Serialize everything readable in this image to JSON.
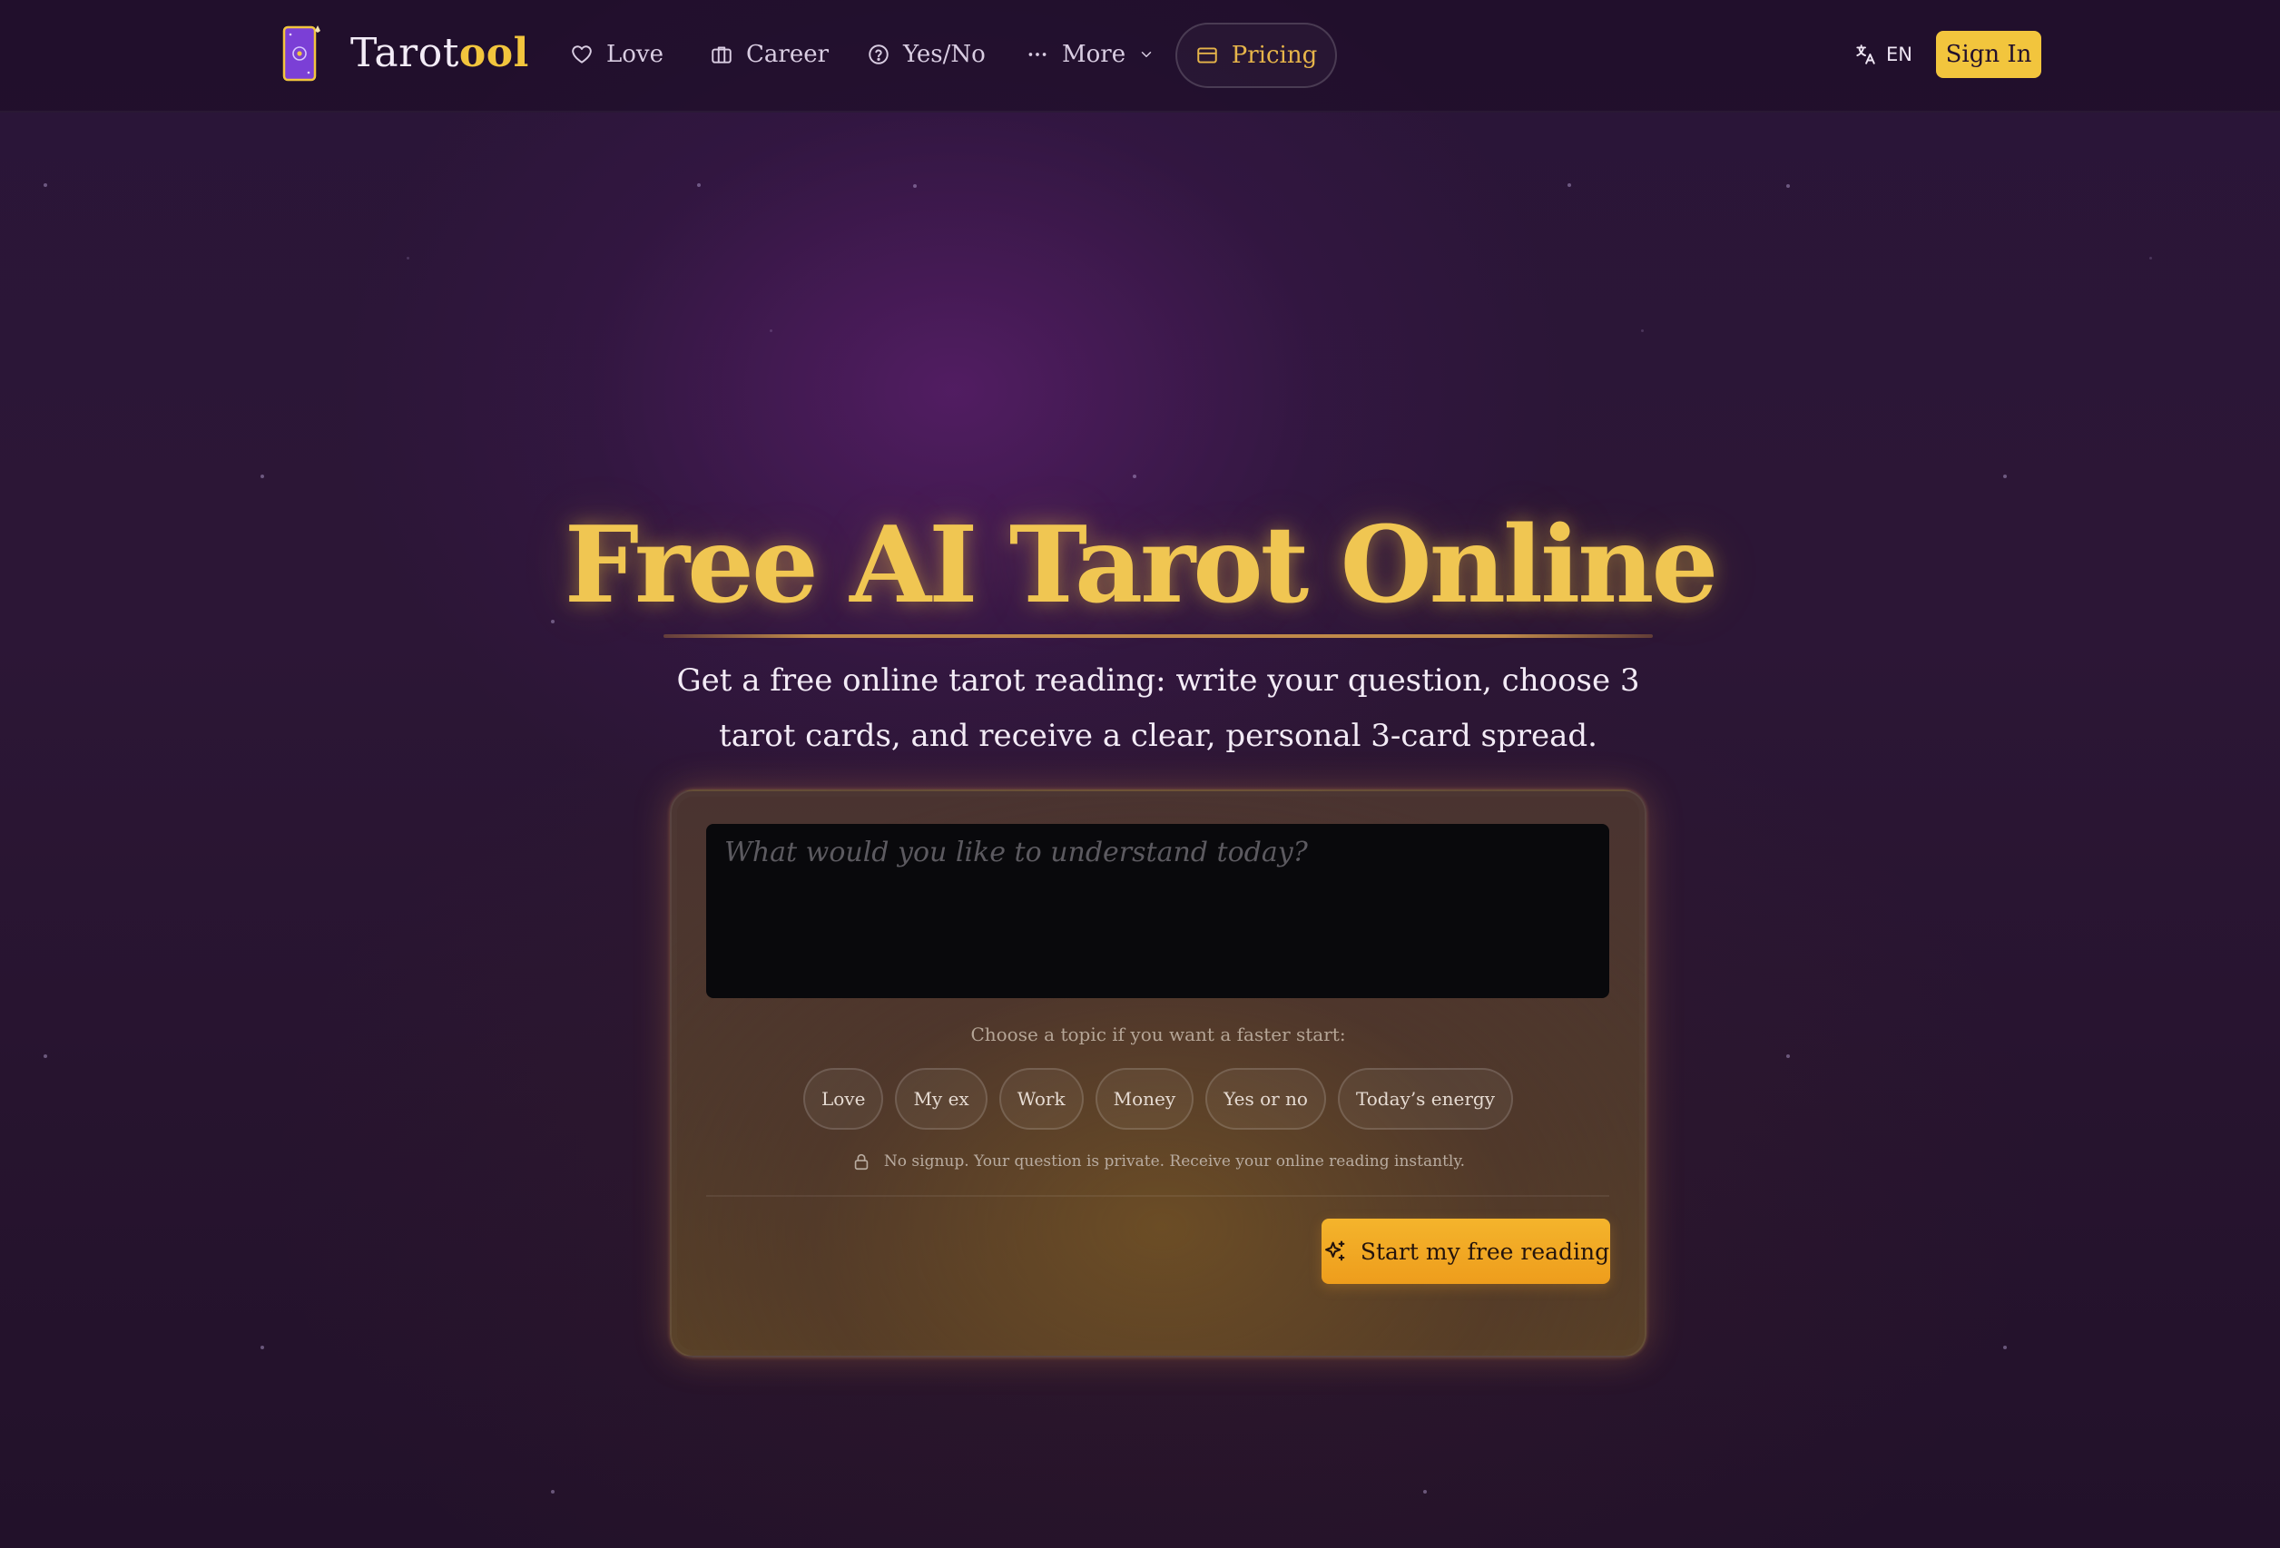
{
  "header": {
    "brand_main": "Tarot",
    "brand_accent": "ool",
    "nav": [
      {
        "label": "Love",
        "icon": "heart-icon"
      },
      {
        "label": "Career",
        "icon": "briefcase-icon"
      },
      {
        "label": "Yes/No",
        "icon": "question-circle-icon"
      },
      {
        "label": "More",
        "icon": "more-dots-icon"
      }
    ],
    "pricing_label": "Pricing",
    "language": "EN",
    "signin_label": "Sign In"
  },
  "hero": {
    "title": "Free AI Tarot Online",
    "subtitle": "Get a free online tarot reading: write your question, choose 3 tarot cards, and receive a clear, personal 3-card spread."
  },
  "reading_form": {
    "question_placeholder": "What would you like to understand today?",
    "question_value": "",
    "topic_prompt": "Choose a topic if you want a faster start:",
    "topics": [
      "Love",
      "My ex",
      "Work",
      "Money",
      "Yes or no",
      "Today’s energy"
    ],
    "privacy_note": "No signup. Your question is private. Receive your online reading instantly.",
    "submit_label": "Start my free reading"
  },
  "colors": {
    "accent_gold": "#f2c53d",
    "cta_orange": "#f4b42c",
    "background_purple": "#2a1538"
  }
}
